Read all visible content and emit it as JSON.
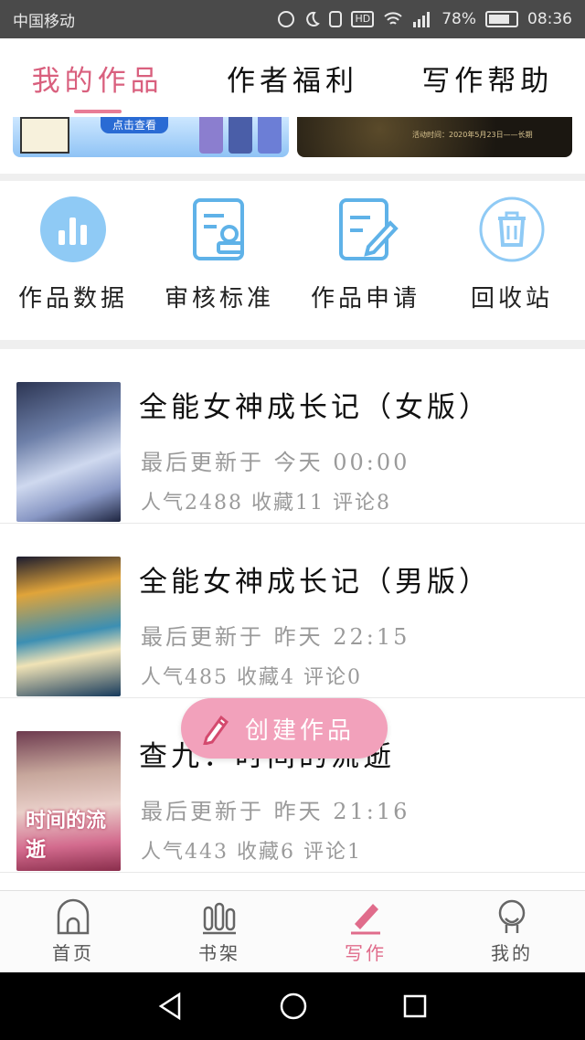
{
  "status_bar": {
    "carrier": "中国移动",
    "battery": "78%",
    "time": "08:36",
    "icons": [
      "nfc-icon",
      "moon-icon",
      "vibrate-icon",
      "hd-icon",
      "wifi-icon",
      "signal-icon",
      "battery-icon"
    ],
    "hd_label": "HD"
  },
  "top_tabs": [
    {
      "label": "我的作品",
      "active": true
    },
    {
      "label": "作者福利",
      "active": false
    },
    {
      "label": "写作帮助",
      "active": false
    }
  ],
  "banners": {
    "left_button": "点击查看",
    "right_caption": "活动时间：2020年5月23日——长期"
  },
  "features": [
    {
      "label": "作品数据",
      "icon": "bar-chart-icon"
    },
    {
      "label": "审核标准",
      "icon": "review-document-icon"
    },
    {
      "label": "作品申请",
      "icon": "edit-document-icon"
    },
    {
      "label": "回收站",
      "icon": "trash-icon"
    }
  ],
  "works": [
    {
      "title": "全能女神成长记（女版）",
      "updated": "最后更新于 今天 00:00",
      "stats": "人气2488 收藏11 评论8"
    },
    {
      "title": "全能女神成长记（男版）",
      "updated": "最后更新于 昨天 22:15",
      "stats": "人气485 收藏4 评论0"
    },
    {
      "title": "查九：时间的流逝",
      "updated": "最后更新于 昨天 21:16",
      "stats": "人气443 收藏6 评论1",
      "cover_text": "时间的流逝"
    }
  ],
  "fab": {
    "label": "创建作品",
    "icon": "pencil-icon"
  },
  "bottom_nav": [
    {
      "label": "首页",
      "icon": "home-icon",
      "active": false
    },
    {
      "label": "书架",
      "icon": "bookshelf-icon",
      "active": false
    },
    {
      "label": "写作",
      "icon": "pencil-icon",
      "active": true
    },
    {
      "label": "我的",
      "icon": "profile-icon",
      "active": false
    }
  ],
  "system_nav": [
    "back-icon",
    "home-circle-icon",
    "recents-icon"
  ],
  "colors": {
    "accent": "#e06c8b",
    "fab": "#f2a1bb",
    "icon_blue": "#5fb2e8"
  }
}
